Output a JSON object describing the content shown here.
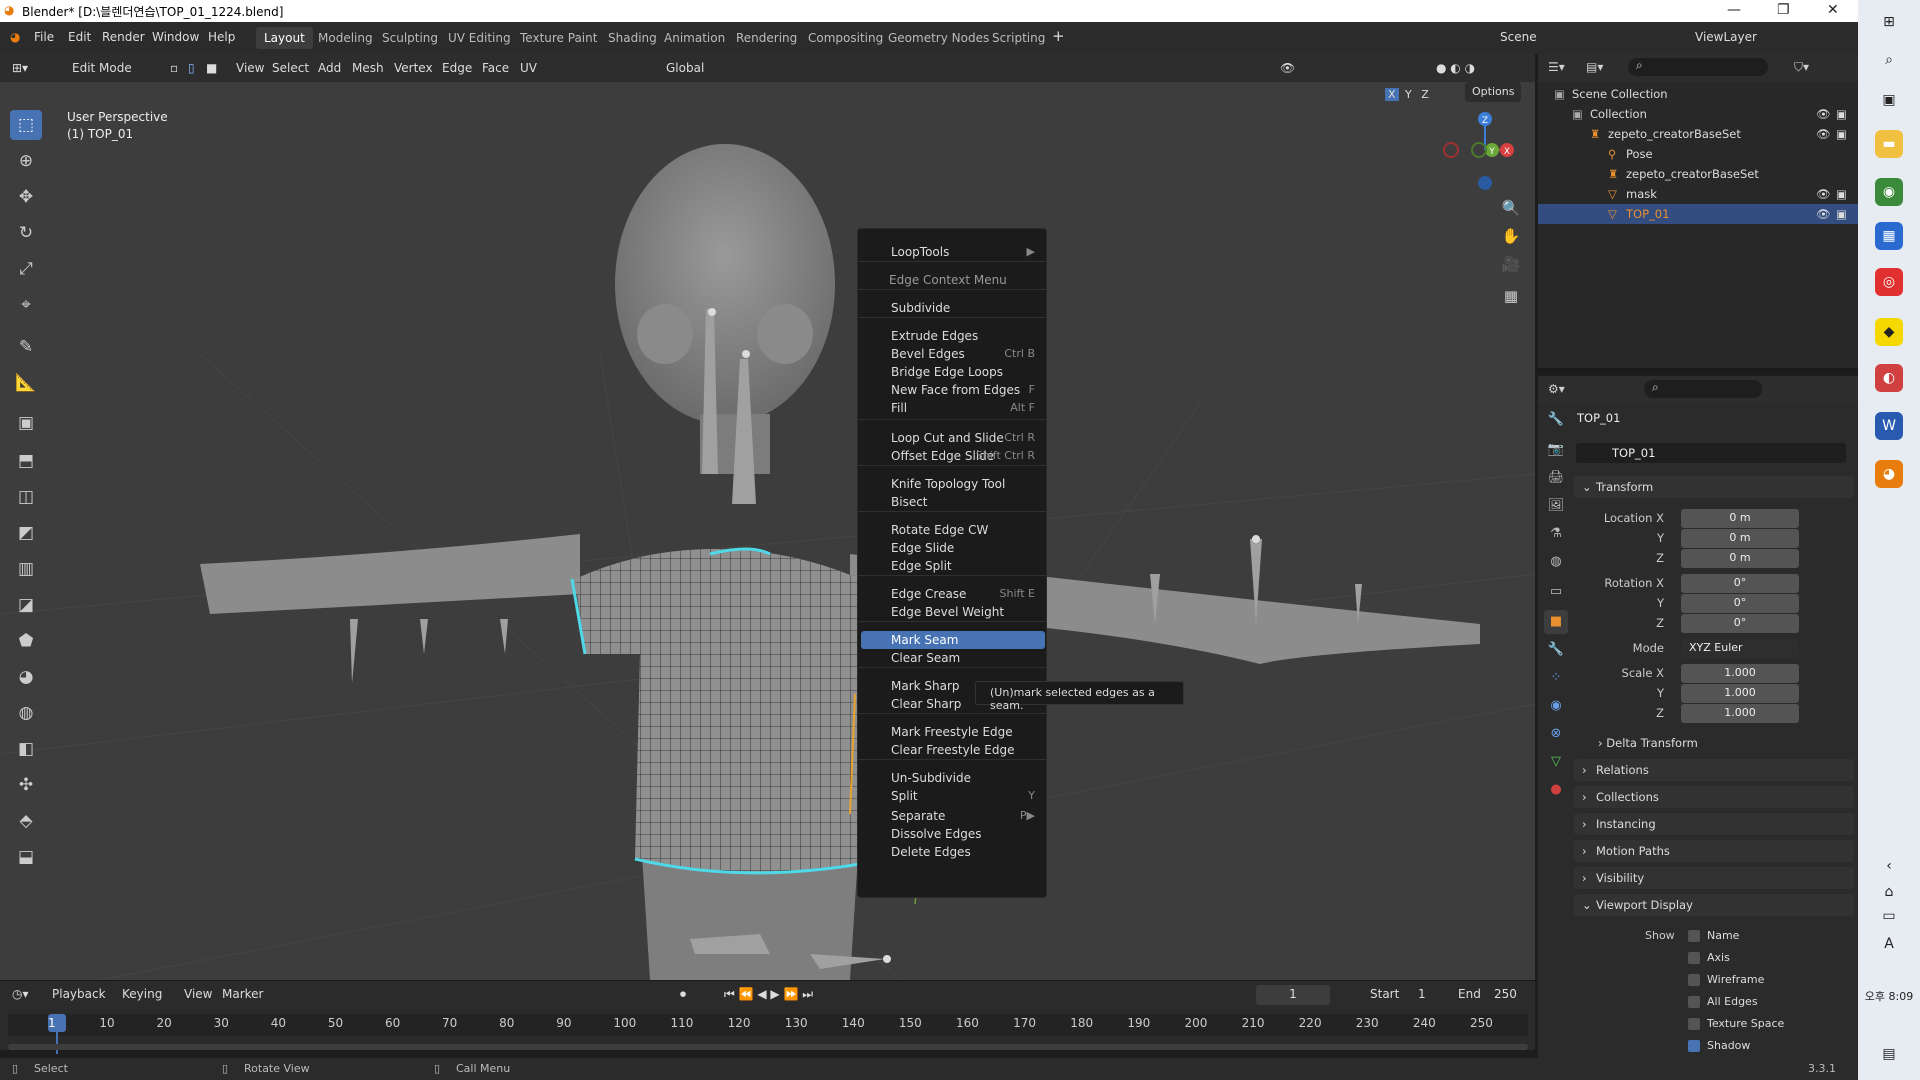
{
  "window": {
    "title": "Blender* [D:\\블렌더연습\\TOP_01_1224.blend]"
  },
  "menu": {
    "items": [
      "File",
      "Edit",
      "Render",
      "Window",
      "Help"
    ]
  },
  "workspaces": [
    "Layout",
    "Modeling",
    "Sculpting",
    "UV Editing",
    "Texture Paint",
    "Shading",
    "Animation",
    "Rendering",
    "Compositing",
    "Geometry Nodes",
    "Scripting"
  ],
  "scene": {
    "name": "Scene",
    "viewlayer": "ViewLayer"
  },
  "viewport_header": {
    "mode": "Edit Mode",
    "menus": [
      "View",
      "Select",
      "Add",
      "Mesh",
      "Vertex",
      "Edge",
      "Face",
      "UV"
    ],
    "orientation": "Global",
    "options": "Options",
    "axes": [
      "X",
      "Y",
      "Z"
    ]
  },
  "viewport": {
    "perspective": "User Perspective",
    "object": "(1) TOP_01"
  },
  "context_menu": {
    "items": [
      {
        "label": "LoopTools",
        "shortcut": "▶"
      },
      {
        "label": "Edge Context Menu",
        "shortcut": "",
        "header": true
      },
      {
        "label": "Subdivide",
        "shortcut": ""
      },
      {
        "label": "Extrude Edges",
        "shortcut": ""
      },
      {
        "label": "Bevel Edges",
        "shortcut": "Ctrl B"
      },
      {
        "label": "Bridge Edge Loops",
        "shortcut": ""
      },
      {
        "label": "New Face from Edges",
        "shortcut": "F"
      },
      {
        "label": "Fill",
        "shortcut": "Alt F"
      },
      {
        "label": "Loop Cut and Slide",
        "shortcut": "Ctrl R"
      },
      {
        "label": "Offset Edge Slide",
        "shortcut": "Shift Ctrl R"
      },
      {
        "label": "Knife Topology Tool",
        "shortcut": ""
      },
      {
        "label": "Bisect",
        "shortcut": ""
      },
      {
        "label": "Rotate Edge CW",
        "shortcut": ""
      },
      {
        "label": "Edge Slide",
        "shortcut": ""
      },
      {
        "label": "Edge Split",
        "shortcut": ""
      },
      {
        "label": "Edge Crease",
        "shortcut": "Shift E"
      },
      {
        "label": "Edge Bevel Weight",
        "shortcut": ""
      },
      {
        "label": "Mark Seam",
        "shortcut": "",
        "highlighted": true
      },
      {
        "label": "Clear Seam",
        "shortcut": ""
      },
      {
        "label": "Mark Sharp",
        "shortcut": ""
      },
      {
        "label": "Clear Sharp",
        "shortcut": ""
      },
      {
        "label": "Mark Freestyle Edge",
        "shortcut": ""
      },
      {
        "label": "Clear Freestyle Edge",
        "shortcut": ""
      },
      {
        "label": "Un-Subdivide",
        "shortcut": ""
      },
      {
        "label": "Split",
        "shortcut": "Y"
      },
      {
        "label": "Separate",
        "shortcut": "P▶"
      },
      {
        "label": "Dissolve Edges",
        "shortcut": ""
      },
      {
        "label": "Delete Edges",
        "shortcut": ""
      }
    ],
    "tooltip": "(Un)mark selected edges as a seam."
  },
  "timeline": {
    "menus": [
      "Playback",
      "Keying",
      "View",
      "Marker"
    ],
    "current_frame": "1",
    "start_label": "Start",
    "start": "1",
    "end_label": "End",
    "end": "250",
    "ticks": [
      "1",
      "10",
      "20",
      "30",
      "40",
      "50",
      "60",
      "70",
      "80",
      "90",
      "100",
      "110",
      "120",
      "130",
      "140",
      "150",
      "160",
      "170",
      "180",
      "190",
      "200",
      "210",
      "220",
      "230",
      "240",
      "250"
    ]
  },
  "statusbar": {
    "select": "Select",
    "rotate": "Rotate View",
    "call_menu": "Call Menu",
    "version": "3.3.1"
  },
  "outliner": {
    "rows": [
      {
        "label": "Scene Collection",
        "indent": 0
      },
      {
        "label": "Collection",
        "indent": 1
      },
      {
        "label": "zepeto_creatorBaseSet",
        "indent": 2
      },
      {
        "label": "Pose",
        "indent": 3
      },
      {
        "label": "zepeto_creatorBaseSet",
        "indent": 3
      },
      {
        "label": "mask",
        "indent": 3
      },
      {
        "label": "TOP_01",
        "indent": 3,
        "selected": true
      }
    ]
  },
  "properties": {
    "object_name": "TOP_01",
    "data_name": "TOP_01",
    "transform_label": "Transform",
    "location": {
      "label": "Location X",
      "x": "0 m",
      "y": "0 m",
      "z": "0 m"
    },
    "rotation": {
      "label": "Rotation X",
      "x": "0°",
      "y": "0°",
      "z": "0°"
    },
    "mode_label": "Mode",
    "mode": "XYZ Euler",
    "scale": {
      "label": "Scale X",
      "x": "1.000",
      "y": "1.000",
      "z": "1.000"
    },
    "axis_y": "Y",
    "axis_z": "Z",
    "delta": "Delta Transform",
    "panels": [
      "Relations",
      "Collections",
      "Instancing",
      "Motion Paths",
      "Visibility"
    ],
    "viewport_display": "Viewport Display",
    "show_label": "Show",
    "show": [
      {
        "label": "Name",
        "checked": false
      },
      {
        "label": "Axis",
        "checked": false
      },
      {
        "label": "Wireframe",
        "checked": false
      },
      {
        "label": "All Edges",
        "checked": false
      },
      {
        "label": "Texture Space",
        "checked": false
      },
      {
        "label": "Shadow",
        "checked": true
      }
    ]
  },
  "taskbar": {
    "time": "오후 8:09",
    "ime": "A"
  },
  "colors": {
    "accent": "#4772b3",
    "seam": "#4fd8e6",
    "orange": "#e87d0d"
  }
}
